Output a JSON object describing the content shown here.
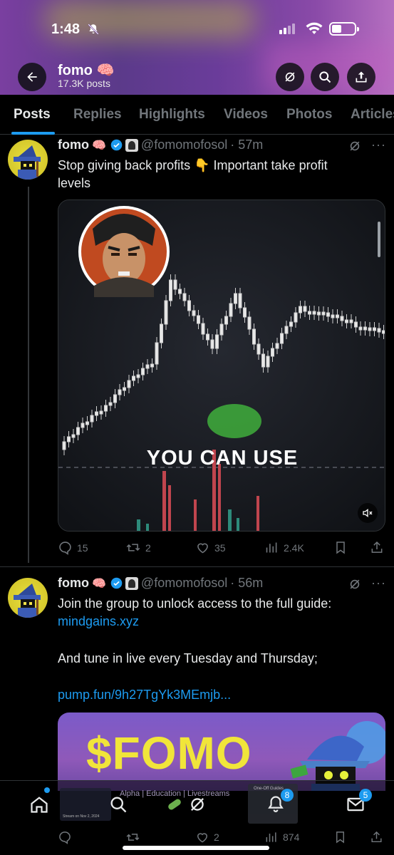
{
  "status_bar": {
    "time": "1:48"
  },
  "profile": {
    "name": "fomo",
    "emoji": "🧠",
    "posts_count": "17.3K posts"
  },
  "tabs": [
    "Posts",
    "Replies",
    "Highlights",
    "Videos",
    "Photos",
    "Articles"
  ],
  "posts": [
    {
      "name": "fomo",
      "emoji": "🧠",
      "handle": "@fomomofosol",
      "time": "· 57m",
      "text_line1": "Stop giving back profits 👇 Important take profit",
      "text_line2": "levels",
      "video_caption": "YOU CAN USE",
      "replies": "15",
      "reposts": "2",
      "likes": "35",
      "views": "2.4K"
    },
    {
      "name": "fomo",
      "emoji": "🧠",
      "handle": "@fomomofosol",
      "time": "· 56m",
      "text_line1": "Join the group to unlock access to the full guide:",
      "link1": "mindgains.xyz",
      "text_line2": "And tune in live every Tuesday and Thursday;",
      "link2": "pump.fun/9h27TgYk3MEmjb...",
      "banner_title": "$FOMO",
      "banner_subtitle": "Alpha | Education | Livestreams",
      "banner_card_title": "One-Off Guides",
      "banner_thumb_date": "Stream on Nov 2, 2024",
      "replies": "",
      "reposts": "",
      "likes": "2",
      "views": "874"
    }
  ],
  "bottom_nav": {
    "notifications_badge": "8",
    "messages_badge": "5"
  },
  "colors": {
    "accent": "#1d9bf0",
    "muted": "#71767b",
    "background": "#000000",
    "text": "#e7e9ea"
  }
}
